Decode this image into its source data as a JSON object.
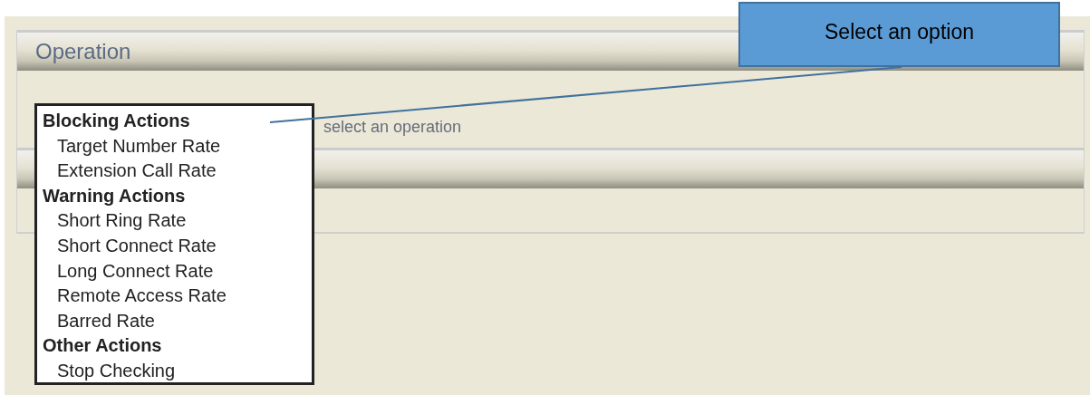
{
  "section": {
    "title": "Operation",
    "hint": "select an operation"
  },
  "dropdown": {
    "groups": [
      {
        "label": "Blocking Actions",
        "options": [
          "Target Number Rate",
          "Extension Call Rate"
        ]
      },
      {
        "label": "Warning Actions",
        "options": [
          "Short Ring Rate",
          "Short Connect Rate",
          "Long Connect Rate",
          "Remote Access Rate",
          "Barred Rate"
        ]
      },
      {
        "label": "Other Actions",
        "options": [
          "Stop Checking"
        ]
      }
    ]
  },
  "callout": {
    "text": "Select an option"
  }
}
